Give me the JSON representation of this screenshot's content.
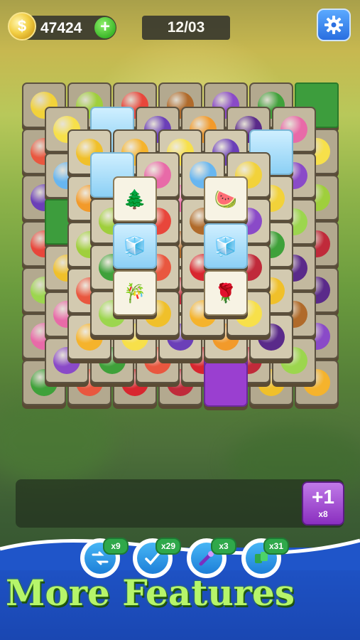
{
  "hud": {
    "coins": "47424",
    "coin_symbol": "$",
    "coin_add_label": "+",
    "level": "12/03",
    "settings_icon": "gear-icon"
  },
  "board": {
    "tile_types": [
      "banana",
      "kiwi",
      "berries",
      "bamboo",
      "grapes",
      "leaf-grass",
      "watermelon",
      "strawberry",
      "rose",
      "pear",
      "apple",
      "star-fruit",
      "lemon",
      "plum",
      "pumpkin",
      "eggplant",
      "pink-flower",
      "snowflake",
      "tree",
      "ice-block"
    ],
    "top_tiles": [
      {
        "name": "tile-tree",
        "icon": "🌲"
      },
      {
        "name": "tile-watermelon",
        "icon": "🍉"
      },
      {
        "name": "tile-ice-1",
        "icon": "🧊"
      },
      {
        "name": "tile-ice-2",
        "icon": "🧊"
      },
      {
        "name": "tile-bamboo",
        "icon": "🎋"
      },
      {
        "name": "tile-rose",
        "icon": "🌹"
      }
    ]
  },
  "tray": {
    "add_slot_label": "+1",
    "add_slot_count": "x8"
  },
  "tools": [
    {
      "name": "shuffle",
      "icon": "shuffle-icon",
      "count": "x9"
    },
    {
      "name": "undo",
      "icon": "undo-icon",
      "count": "x29"
    },
    {
      "name": "magic",
      "icon": "wand-icon",
      "count": "x3"
    },
    {
      "name": "hint",
      "icon": "tiles-icon",
      "count": "x31"
    }
  ],
  "promo": {
    "text": "More Features"
  },
  "colors": {
    "panel": "#1f55c9",
    "promo_text": "#b6f56a",
    "tray_button": "#8a2fbf"
  }
}
